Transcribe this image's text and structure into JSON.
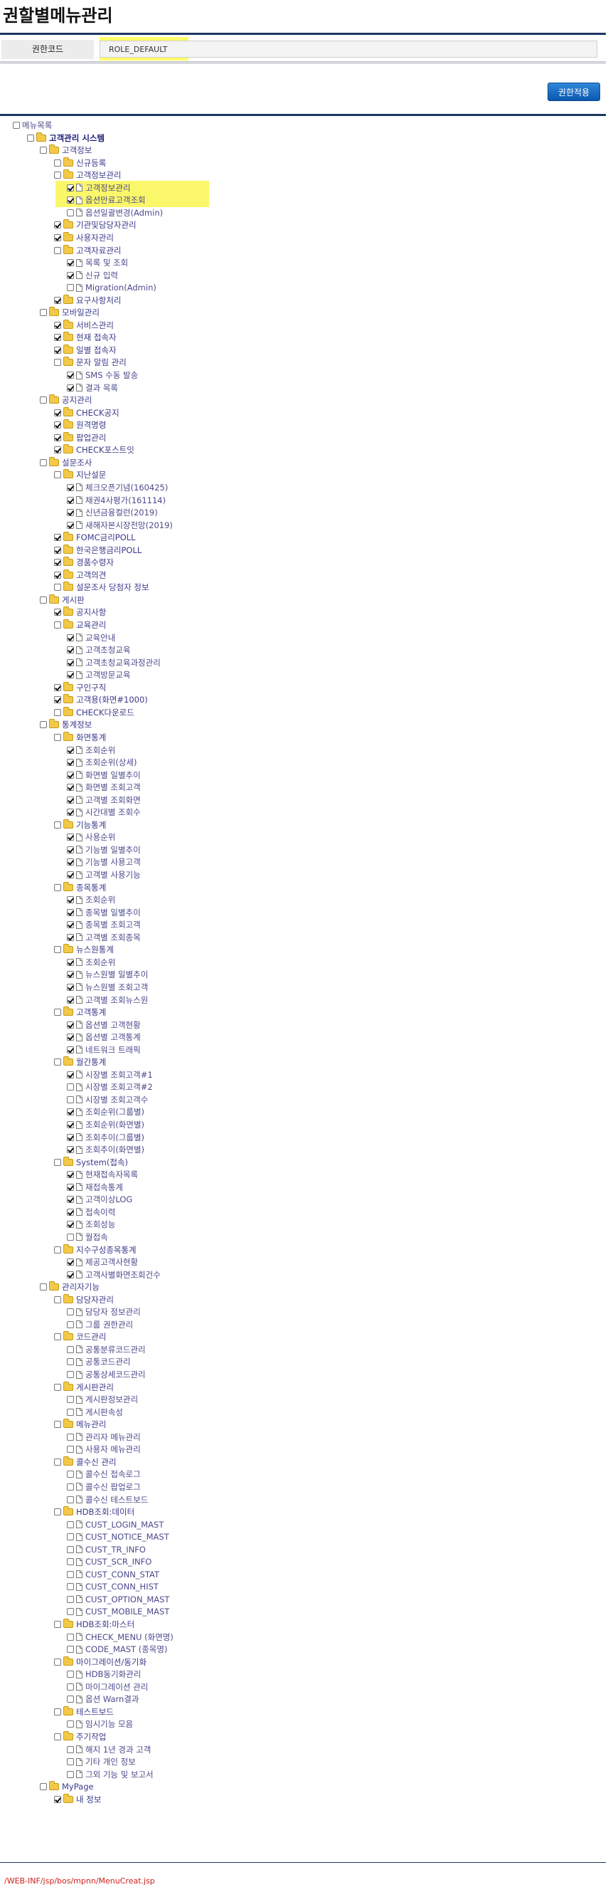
{
  "page_title": "권할별메뉴관리",
  "form": {
    "label": "권한코드",
    "value": "ROLE_DEFAULT"
  },
  "apply_button": "권한적용",
  "footer_path": "/WEB-INF/jsp/bos/mpnn/MenuCreat.jsp",
  "tree": [
    {
      "label": "메뉴목록",
      "level": 0,
      "icon": "page",
      "checked": false
    },
    {
      "label": "고객관리 시스템",
      "level": 1,
      "icon": "folder",
      "checked": false,
      "bold": true
    },
    {
      "label": "고객정보",
      "level": 2,
      "icon": "folder",
      "checked": false
    },
    {
      "label": "신규등록",
      "level": 3,
      "icon": "folder",
      "checked": false
    },
    {
      "label": "고객정보관리",
      "level": 3,
      "icon": "folder",
      "checked": false
    },
    {
      "label": "고객정보관리",
      "level": 4,
      "icon": "page",
      "checked": true,
      "highlight": true
    },
    {
      "label": "옵션만료고객조회",
      "level": 4,
      "icon": "page",
      "checked": true,
      "highlight": true
    },
    {
      "label": "옵션일괄변경(Admin)",
      "level": 4,
      "icon": "page",
      "checked": false
    },
    {
      "label": "기관및담당자관리",
      "level": 3,
      "icon": "folder",
      "checked": true
    },
    {
      "label": "사용자관리",
      "level": 3,
      "icon": "folder",
      "checked": true
    },
    {
      "label": "고객자료관리",
      "level": 3,
      "icon": "folder",
      "checked": false
    },
    {
      "label": "목록 및 조회",
      "level": 4,
      "icon": "page",
      "checked": true
    },
    {
      "label": "신규 입력",
      "level": 4,
      "icon": "page",
      "checked": true
    },
    {
      "label": "Migration(Admin)",
      "level": 4,
      "icon": "page",
      "checked": false
    },
    {
      "label": "요구사항처리",
      "level": 3,
      "icon": "folder",
      "checked": true
    },
    {
      "label": "모바일관리",
      "level": 2,
      "icon": "folder",
      "checked": false
    },
    {
      "label": "서비스관리",
      "level": 3,
      "icon": "folder",
      "checked": true
    },
    {
      "label": "현재 접속자",
      "level": 3,
      "icon": "folder",
      "checked": true
    },
    {
      "label": "일별 접속자",
      "level": 3,
      "icon": "folder",
      "checked": true
    },
    {
      "label": "문자 알림 관리",
      "level": 3,
      "icon": "folder",
      "checked": false
    },
    {
      "label": "SMS 수동 발송",
      "level": 4,
      "icon": "page",
      "checked": true
    },
    {
      "label": "결과 목록",
      "level": 4,
      "icon": "page",
      "checked": true
    },
    {
      "label": "공지관리",
      "level": 2,
      "icon": "folder",
      "checked": false
    },
    {
      "label": "CHECK공지",
      "level": 3,
      "icon": "folder",
      "checked": true
    },
    {
      "label": "원격명령",
      "level": 3,
      "icon": "folder",
      "checked": true
    },
    {
      "label": "팝업관리",
      "level": 3,
      "icon": "folder",
      "checked": true
    },
    {
      "label": "CHECK포스트잇",
      "level": 3,
      "icon": "folder",
      "checked": true
    },
    {
      "label": "설문조사",
      "level": 2,
      "icon": "folder",
      "checked": false
    },
    {
      "label": "지난설문",
      "level": 3,
      "icon": "folder",
      "checked": false
    },
    {
      "label": "체크오픈기념(160425)",
      "level": 4,
      "icon": "page",
      "checked": true
    },
    {
      "label": "채권4사평가(161114)",
      "level": 4,
      "icon": "page",
      "checked": true
    },
    {
      "label": "신년금융컬런(2019)",
      "level": 4,
      "icon": "page",
      "checked": true
    },
    {
      "label": "새해자본시장전망(2019)",
      "level": 4,
      "icon": "page",
      "checked": true
    },
    {
      "label": "FOMC금리POLL",
      "level": 3,
      "icon": "folder",
      "checked": true
    },
    {
      "label": "한국은행금리POLL",
      "level": 3,
      "icon": "folder",
      "checked": true
    },
    {
      "label": "경품수령자",
      "level": 3,
      "icon": "folder",
      "checked": true
    },
    {
      "label": "고객의견",
      "level": 3,
      "icon": "folder",
      "checked": true
    },
    {
      "label": "설문조사 당첨자 정보",
      "level": 3,
      "icon": "folder",
      "checked": false
    },
    {
      "label": "게시판",
      "level": 2,
      "icon": "folder",
      "checked": false
    },
    {
      "label": "공지사항",
      "level": 3,
      "icon": "folder",
      "checked": true
    },
    {
      "label": "교육관리",
      "level": 3,
      "icon": "folder",
      "checked": false
    },
    {
      "label": "교육안내",
      "level": 4,
      "icon": "page",
      "checked": true
    },
    {
      "label": "고객초청교육",
      "level": 4,
      "icon": "page",
      "checked": true
    },
    {
      "label": "고객초청교육과정관리",
      "level": 4,
      "icon": "page",
      "checked": true
    },
    {
      "label": "고객방문교육",
      "level": 4,
      "icon": "page",
      "checked": true
    },
    {
      "label": "구인구직",
      "level": 3,
      "icon": "folder",
      "checked": true
    },
    {
      "label": "고객용(화면#1000)",
      "level": 3,
      "icon": "folder",
      "checked": true
    },
    {
      "label": "CHECK다운로드",
      "level": 3,
      "icon": "folder",
      "checked": false
    },
    {
      "label": "통계정보",
      "level": 2,
      "icon": "folder",
      "checked": false
    },
    {
      "label": "화면통계",
      "level": 3,
      "icon": "folder",
      "checked": false
    },
    {
      "label": "조회순위",
      "level": 4,
      "icon": "page",
      "checked": true
    },
    {
      "label": "조회순위(상세)",
      "level": 4,
      "icon": "page",
      "checked": true
    },
    {
      "label": "화면별 일별추이",
      "level": 4,
      "icon": "page",
      "checked": true
    },
    {
      "label": "화면별 조회고객",
      "level": 4,
      "icon": "page",
      "checked": true
    },
    {
      "label": "고객별 조회화면",
      "level": 4,
      "icon": "page",
      "checked": true
    },
    {
      "label": "시간대별 조회수",
      "level": 4,
      "icon": "page",
      "checked": true
    },
    {
      "label": "기능통계",
      "level": 3,
      "icon": "folder",
      "checked": false
    },
    {
      "label": "사용순위",
      "level": 4,
      "icon": "page",
      "checked": true
    },
    {
      "label": "기능별 일별추이",
      "level": 4,
      "icon": "page",
      "checked": true
    },
    {
      "label": "기능별 사용고객",
      "level": 4,
      "icon": "page",
      "checked": true
    },
    {
      "label": "고객별 사용기능",
      "level": 4,
      "icon": "page",
      "checked": true
    },
    {
      "label": "종목통계",
      "level": 3,
      "icon": "folder",
      "checked": false
    },
    {
      "label": "조회순위",
      "level": 4,
      "icon": "page",
      "checked": true
    },
    {
      "label": "종목별 일별추이",
      "level": 4,
      "icon": "page",
      "checked": true
    },
    {
      "label": "종목별 조회고객",
      "level": 4,
      "icon": "page",
      "checked": true
    },
    {
      "label": "고객별 조회종목",
      "level": 4,
      "icon": "page",
      "checked": true
    },
    {
      "label": "뉴스원통계",
      "level": 3,
      "icon": "folder",
      "checked": false
    },
    {
      "label": "조회순위",
      "level": 4,
      "icon": "page",
      "checked": true
    },
    {
      "label": "뉴스원별 일별추이",
      "level": 4,
      "icon": "page",
      "checked": true
    },
    {
      "label": "뉴스원별 조회고객",
      "level": 4,
      "icon": "page",
      "checked": true
    },
    {
      "label": "고객별 조회뉴스원",
      "level": 4,
      "icon": "page",
      "checked": true
    },
    {
      "label": "고객통계",
      "level": 3,
      "icon": "folder",
      "checked": false
    },
    {
      "label": "옵션별 고객현황",
      "level": 4,
      "icon": "page",
      "checked": true
    },
    {
      "label": "옵션별 고객통계",
      "level": 4,
      "icon": "page",
      "checked": true
    },
    {
      "label": "네트워크 트래픽",
      "level": 4,
      "icon": "page",
      "checked": true
    },
    {
      "label": "월간통계",
      "level": 3,
      "icon": "folder",
      "checked": false
    },
    {
      "label": "시장별 조회고객#1",
      "level": 4,
      "icon": "page",
      "checked": true
    },
    {
      "label": "시장별 조회고객#2",
      "level": 4,
      "icon": "page",
      "checked": false
    },
    {
      "label": "시장별 조회고객수",
      "level": 4,
      "icon": "page",
      "checked": false
    },
    {
      "label": "조회순위(그룹별)",
      "level": 4,
      "icon": "page",
      "checked": true
    },
    {
      "label": "조회순위(화면별)",
      "level": 4,
      "icon": "page",
      "checked": true
    },
    {
      "label": "조회추이(그룹별)",
      "level": 4,
      "icon": "page",
      "checked": true
    },
    {
      "label": "조회추이(화면별)",
      "level": 4,
      "icon": "page",
      "checked": true
    },
    {
      "label": "System(접속)",
      "level": 3,
      "icon": "folder",
      "checked": false
    },
    {
      "label": "현재접속자목록",
      "level": 4,
      "icon": "page",
      "checked": true
    },
    {
      "label": "재접속통계",
      "level": 4,
      "icon": "page",
      "checked": true
    },
    {
      "label": "고객이상LOG",
      "level": 4,
      "icon": "page",
      "checked": true
    },
    {
      "label": "접속이력",
      "level": 4,
      "icon": "page",
      "checked": true
    },
    {
      "label": "조회성능",
      "level": 4,
      "icon": "page",
      "checked": true
    },
    {
      "label": "월접속",
      "level": 4,
      "icon": "page",
      "checked": false
    },
    {
      "label": "지수구성종목통계",
      "level": 3,
      "icon": "folder",
      "checked": false
    },
    {
      "label": "제공고객사현황",
      "level": 4,
      "icon": "page",
      "checked": true
    },
    {
      "label": "고객사별화면조회건수",
      "level": 4,
      "icon": "page",
      "checked": true
    },
    {
      "label": "관리자기능",
      "level": 2,
      "icon": "folder",
      "checked": false
    },
    {
      "label": "담당자관리",
      "level": 3,
      "icon": "folder",
      "checked": false
    },
    {
      "label": "담당자 정보관리",
      "level": 4,
      "icon": "page",
      "checked": false
    },
    {
      "label": "그룹 권한관리",
      "level": 4,
      "icon": "page",
      "checked": false
    },
    {
      "label": "코드관리",
      "level": 3,
      "icon": "folder",
      "checked": false
    },
    {
      "label": "공통분류코드관리",
      "level": 4,
      "icon": "page",
      "checked": false
    },
    {
      "label": "공통코드관리",
      "level": 4,
      "icon": "page",
      "checked": false
    },
    {
      "label": "공통상세코드관리",
      "level": 4,
      "icon": "page",
      "checked": false
    },
    {
      "label": "게시판관리",
      "level": 3,
      "icon": "folder",
      "checked": false
    },
    {
      "label": "게시판정보관리",
      "level": 4,
      "icon": "page",
      "checked": false
    },
    {
      "label": "게시판속성",
      "level": 4,
      "icon": "page",
      "checked": false
    },
    {
      "label": "메뉴관리",
      "level": 3,
      "icon": "folder",
      "checked": false
    },
    {
      "label": "관리자 메뉴관리",
      "level": 4,
      "icon": "page",
      "checked": false
    },
    {
      "label": "사용자 메뉴관리",
      "level": 4,
      "icon": "page",
      "checked": false
    },
    {
      "label": "콜수신 관리",
      "level": 3,
      "icon": "folder",
      "checked": false
    },
    {
      "label": "콜수신 접속로그",
      "level": 4,
      "icon": "page",
      "checked": false
    },
    {
      "label": "콜수신 팝업로그",
      "level": 4,
      "icon": "page",
      "checked": false
    },
    {
      "label": "콜수신 테스트보드",
      "level": 4,
      "icon": "page",
      "checked": false
    },
    {
      "label": "HDB조회:데이터",
      "level": 3,
      "icon": "folder",
      "checked": false
    },
    {
      "label": "CUST_LOGIN_MAST",
      "level": 4,
      "icon": "page",
      "checked": false
    },
    {
      "label": "CUST_NOTICE_MAST",
      "level": 4,
      "icon": "page",
      "checked": false
    },
    {
      "label": "CUST_TR_INFO",
      "level": 4,
      "icon": "page",
      "checked": false
    },
    {
      "label": "CUST_SCR_INFO",
      "level": 4,
      "icon": "page",
      "checked": false
    },
    {
      "label": "CUST_CONN_STAT",
      "level": 4,
      "icon": "page",
      "checked": false
    },
    {
      "label": "CUST_CONN_HIST",
      "level": 4,
      "icon": "page",
      "checked": false
    },
    {
      "label": "CUST_OPTION_MAST",
      "level": 4,
      "icon": "page",
      "checked": false
    },
    {
      "label": "CUST_MOBILE_MAST",
      "level": 4,
      "icon": "page",
      "checked": false
    },
    {
      "label": "HDB조회:마스터",
      "level": 3,
      "icon": "folder",
      "checked": false
    },
    {
      "label": "CHECK_MENU (화면명)",
      "level": 4,
      "icon": "page",
      "checked": false
    },
    {
      "label": "CODE_MAST (종목명)",
      "level": 4,
      "icon": "page",
      "checked": false
    },
    {
      "label": "마이그레이션/동기화",
      "level": 3,
      "icon": "folder",
      "checked": false
    },
    {
      "label": "HDB동기화관리",
      "level": 4,
      "icon": "page",
      "checked": false
    },
    {
      "label": "마이그레이션 관리",
      "level": 4,
      "icon": "page",
      "checked": false
    },
    {
      "label": "옵션 Warn결과",
      "level": 4,
      "icon": "page",
      "checked": false
    },
    {
      "label": "테스트보드",
      "level": 3,
      "icon": "folder",
      "checked": false
    },
    {
      "label": "임시기능 모음",
      "level": 4,
      "icon": "page",
      "checked": false
    },
    {
      "label": "주기작업",
      "level": 3,
      "icon": "folder",
      "checked": false
    },
    {
      "label": "해지 1년 경과 고객",
      "level": 4,
      "icon": "page",
      "checked": false
    },
    {
      "label": "기타 개인 정보",
      "level": 4,
      "icon": "page",
      "checked": false
    },
    {
      "label": "그외 기능 및 보고서",
      "level": 4,
      "icon": "page",
      "checked": false
    },
    {
      "label": "MyPage",
      "level": 2,
      "icon": "folder",
      "checked": false
    },
    {
      "label": "내 정보",
      "level": 3,
      "icon": "folder",
      "checked": true
    }
  ]
}
